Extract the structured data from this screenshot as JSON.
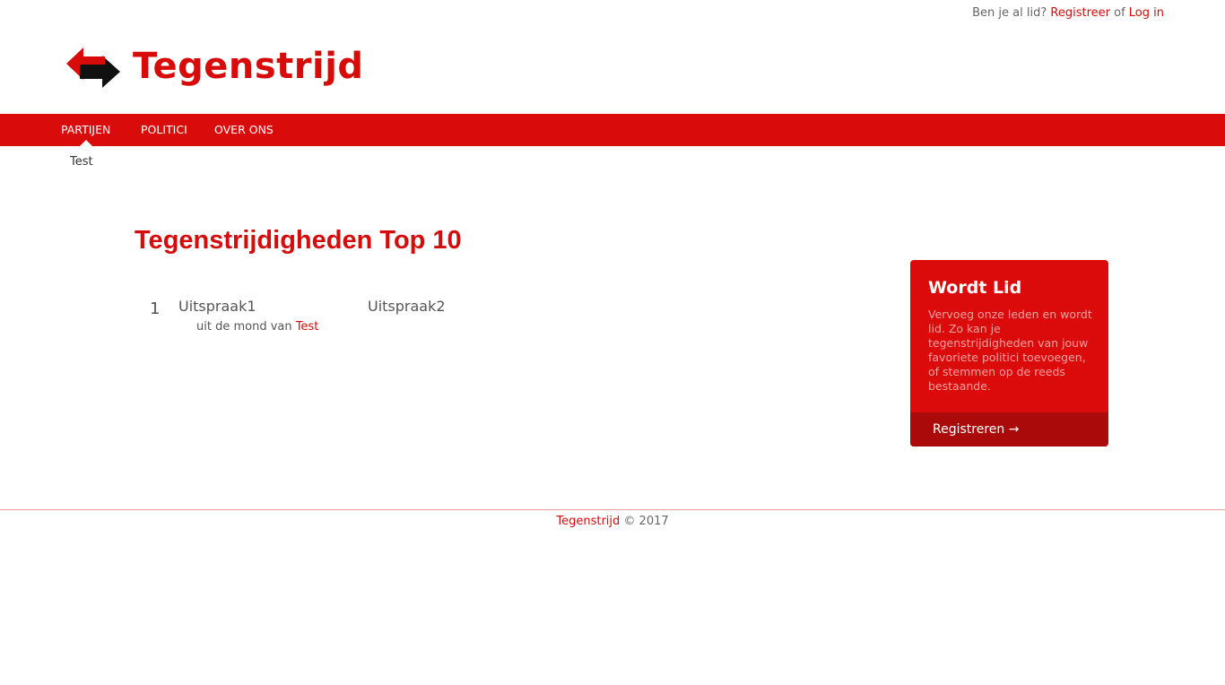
{
  "topbar": {
    "prompt": "Ben je al lid?",
    "register_link": "Registreer",
    "or": "of",
    "login_link": "Log in"
  },
  "brand": {
    "name": "Tegenstrijd",
    "icon": "double-arrow-logo-icon"
  },
  "nav": {
    "items": [
      {
        "label": "Partijen"
      },
      {
        "label": "Politici"
      },
      {
        "label": "Over ons"
      }
    ]
  },
  "subnav": {
    "items": [
      {
        "label": "Test"
      }
    ]
  },
  "main": {
    "heading": "Tegenstrijdigheden Top 10",
    "entries": [
      {
        "rank": "1",
        "statement1": "Uitspraak1",
        "statement2": "Uitspraak2",
        "by_prefix": "uit de mond van",
        "by_name": "Test"
      }
    ]
  },
  "sidebar": {
    "title": "Wordt Lid",
    "text": "Vervoeg onze leden en wordt lid. Zo kan je tegenstrijdigheden van jouw favoriete politici toevoegen, of stemmen op de reeds bestaande.",
    "button": "Registreren →"
  },
  "footer": {
    "brand": "Tegenstrijd",
    "copyright": "© 2017"
  },
  "colors": {
    "accent": "#da0b0b",
    "accent_dark": "#ab0a0a",
    "link": "#d40c0c"
  }
}
